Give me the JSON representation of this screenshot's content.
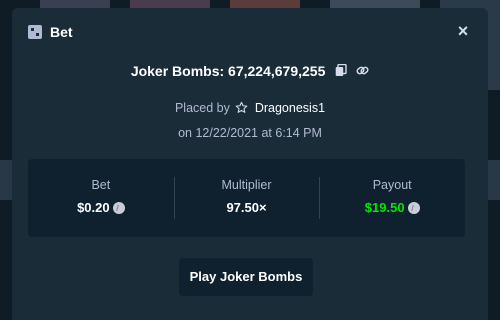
{
  "modal": {
    "title": "Bet",
    "close_symbol": "×",
    "header_icon": "bet-slip-icon"
  },
  "bet": {
    "game_id_line": "Joker Bombs: 67,224,679,255",
    "copy_icon": "copy-icon",
    "link_icon": "link-icon",
    "placed_by_prefix": "Placed by",
    "user_icon": "star-icon",
    "username": "Dragonesis1",
    "placed_on": "on 12/22/2021 at 6:14 PM"
  },
  "stats": [
    {
      "label": "Bet",
      "value": "$0.20",
      "icon": "coin-icon",
      "color": "#ffffff"
    },
    {
      "label": "Multiplier",
      "value": "97.50×",
      "icon": null,
      "color": "#ffffff"
    },
    {
      "label": "Payout",
      "value": "$19.50",
      "icon": "coin-icon",
      "color": "#00e701"
    }
  ],
  "play_button_label": "Play Joker Bombs",
  "colors": {
    "modal_bg": "#1a2c38",
    "panel_bg": "#0f212e",
    "muted_text": "#b1bad3",
    "payout_green": "#00e701"
  }
}
